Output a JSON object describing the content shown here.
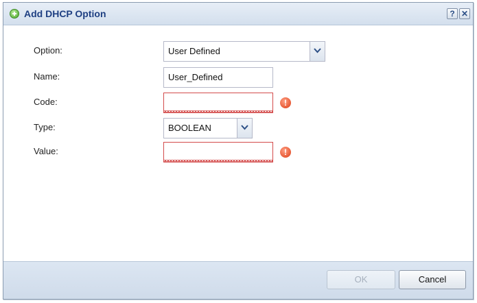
{
  "dialog": {
    "title": "Add DHCP Option",
    "help_label": "?",
    "close_label": "✕"
  },
  "form": {
    "option": {
      "label": "Option:",
      "value": "User Defined"
    },
    "name": {
      "label": "Name:",
      "value": "User_Defined"
    },
    "code": {
      "label": "Code:",
      "value": "",
      "error_icon": "!"
    },
    "type": {
      "label": "Type:",
      "value": "BOOLEAN"
    },
    "value": {
      "label": "Value:",
      "value": "",
      "error_icon": "!"
    }
  },
  "footer": {
    "ok_label": "OK",
    "cancel_label": "Cancel"
  },
  "colors": {
    "title": "#1e3f82",
    "error": "#d34a4a",
    "accent_add": "#4aa62a"
  }
}
